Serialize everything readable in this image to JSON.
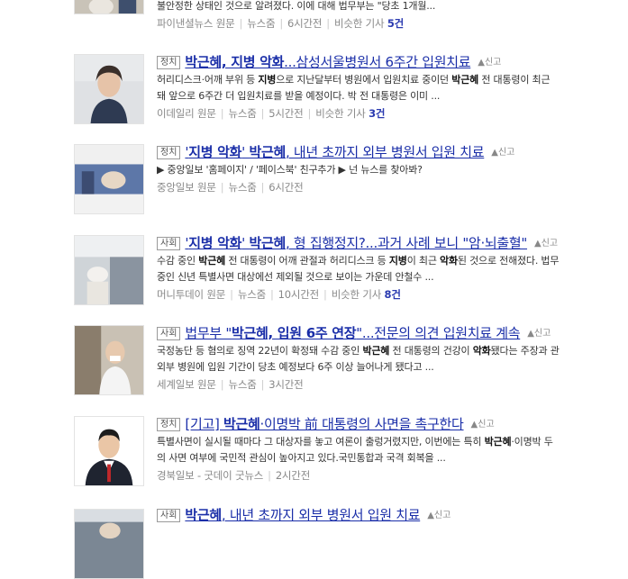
{
  "items": [
    {
      "snippet": "불안정한 상태인 것으로 알려졌다. 이에 대해 법무부는 \"당초 1개월...",
      "press": "파이낸셜뉴스",
      "meta_original": "원문",
      "meta_news": "뉴스줌",
      "time": "6시간전",
      "similar": "비슷한 기사",
      "similar_count": "5건"
    },
    {
      "category": "정치",
      "title_bold": "박근혜, 지병 악화",
      "title_rest": "...삼성서울병원서 6주간 입원치료",
      "report": "신고",
      "snippet_parts": [
        "허리디스크·어깨 부위 등 ",
        "지병",
        "으로 지난달부터 병원에서 입원치료 중이던 ",
        "박근혜",
        " 전 대통령이 최근 "
      ],
      "snippet2": "돼 앞으로 6주간 더 입원치료를 받을 예정이다. 박 전 대통령은 이미 ...",
      "press": "이데일리",
      "meta_original": "원문",
      "meta_news": "뉴스줌",
      "time": "5시간전",
      "similar": "비슷한 기사",
      "similar_count": "3건"
    },
    {
      "category": "정치",
      "title_q1": "'",
      "title_bold": "지병 악화",
      "title_q2": "' ",
      "title_bold2": "박근혜",
      "title_rest": ", 내년 초까지 외부 병원서 입원 치료",
      "report": "신고",
      "snippet": "▶ 중앙일보 '홈페이지' / '페이스북' 친구추가 ▶ 넌 뉴스를 찾아봐?",
      "press": "중앙일보",
      "meta_original": "원문",
      "meta_news": "뉴스줌",
      "time": "6시간전"
    },
    {
      "category": "사회",
      "title_q1": "'",
      "title_bold": "지병 악화",
      "title_q2": "' ",
      "title_bold2": "박근혜",
      "title_rest": ", 형 집행정지?...과거 사례 보니 \"암·뇌출혈\"",
      "report": "신고",
      "snippet_parts": [
        "수감 중인 ",
        "박근혜",
        " 전 대통령이 어깨 관절과 허리디스크 등 ",
        "지병",
        "이 최근 ",
        "악화",
        "된 것으로 전해졌다. 법무"
      ],
      "snippet2": "중인 신년 특별사면 대상에선 제외될 것으로 보이는 가운데 안철수 ...",
      "press": "머니투데이",
      "meta_original": "원문",
      "meta_news": "뉴스줌",
      "time": "10시간전",
      "similar": "비슷한 기사",
      "similar_count": "8건"
    },
    {
      "category": "사회",
      "title_pre": "법무부 \"",
      "title_bold": "박근혜, 입원 6주 연장",
      "title_rest": "\"...전문의 의견 입원치료 계속",
      "report": "신고",
      "snippet_parts": [
        "국정농단 등 혐의로 징역 22년이 확정돼 수감 중인 ",
        "박근혜",
        " 전 대통령의 건강이 ",
        "악화",
        "됐다는 주장과 관"
      ],
      "snippet2": "외부 병원에 입원 기간이 당초 예정보다 6주 이상 늘어나게 됐다고 ...",
      "press": "세계일보",
      "meta_original": "원문",
      "meta_news": "뉴스줌",
      "time": "3시간전"
    },
    {
      "category": "정치",
      "title_pre": "[기고] ",
      "title_bold": "박근혜",
      "title_rest": "·이명박 前 대통령의 사면을 촉구한다",
      "report": "신고",
      "snippet_parts": [
        "특별사면이 실시될 때마다 그 대상자를 놓고 여론이 출렁거렸지만, 이번에는 특히 ",
        "박근혜",
        "·이명박 두"
      ],
      "snippet2": "의 사면 여부에 국민적 관심이 높아지고 있다.국민통합과 국격 회복을 ...",
      "press": "경북일보 - 굿데이 굿뉴스",
      "time": "2시간전"
    },
    {
      "category": "사회",
      "title_bold": "박근혜",
      "title_rest": ", 내년 초까지 외부 병원서 입원 치료",
      "report": "신고"
    }
  ],
  "icons": {
    "report": "alarm-report-icon"
  },
  "colors": {
    "title": "#1a2ea8",
    "press": "#2b8a2b",
    "meta": "#888888"
  }
}
